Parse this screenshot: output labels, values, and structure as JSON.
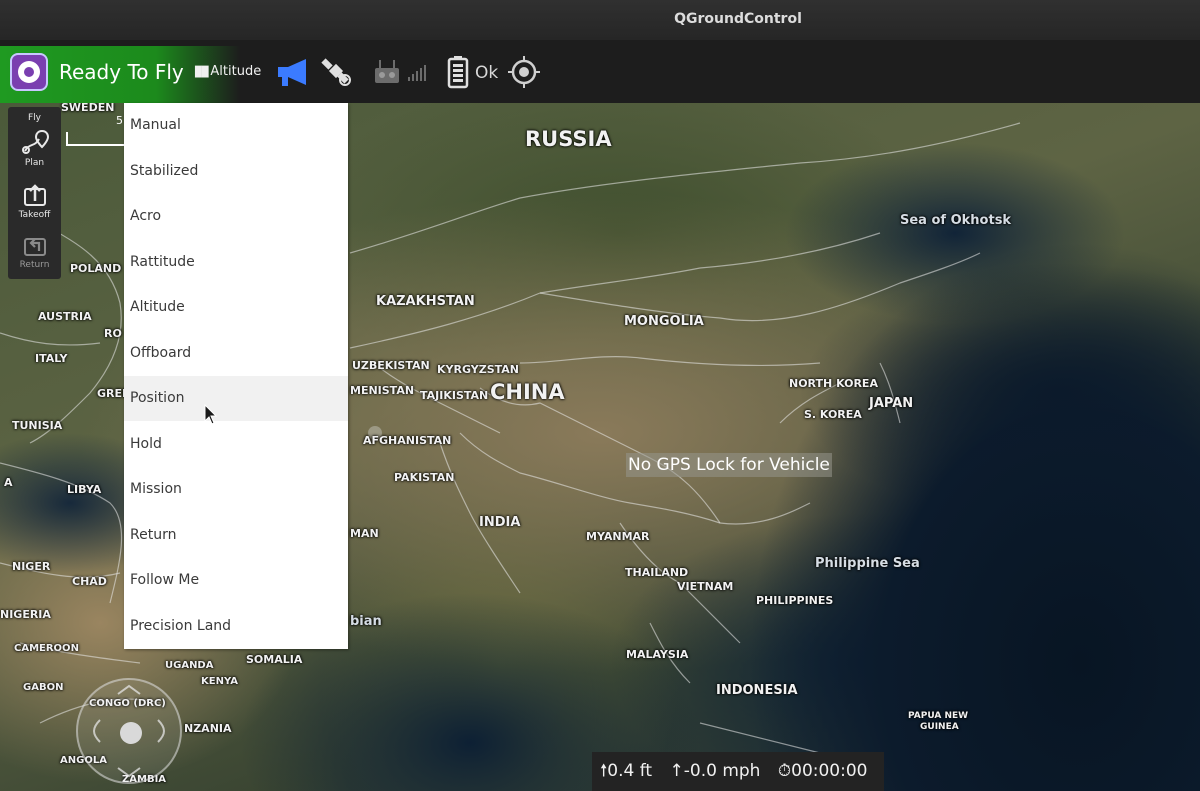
{
  "window": {
    "title": "QGroundControl"
  },
  "toolbar": {
    "status": "Ready To Fly",
    "flight_mode": "Altitude",
    "battery_status": "Ok",
    "icons": [
      "qgc-logo-icon",
      "megaphone-icon",
      "satellite-icon",
      "rc-transmitter-icon",
      "signal-bars-icon",
      "battery-icon",
      "gps-target-icon"
    ],
    "armed_color": "#1f9a21",
    "accent_color": "#3b7bff"
  },
  "toolstrip": {
    "items": [
      {
        "label": "Fly",
        "icon": "fly-icon"
      },
      {
        "label": "Plan",
        "icon": "plan-route-icon"
      },
      {
        "label": "Takeoff",
        "icon": "takeoff-icon"
      },
      {
        "label": "Return",
        "icon": "return-icon"
      }
    ]
  },
  "scale": {
    "value": "5"
  },
  "menu": {
    "items": [
      "Manual",
      "Stabilized",
      "Acro",
      "Rattitude",
      "Altitude",
      "Offboard",
      "Position",
      "Hold",
      "Mission",
      "Return",
      "Follow Me",
      "Precision Land"
    ],
    "hovered": "Position"
  },
  "map": {
    "labels": {
      "russia": "RUSSIA",
      "china": "CHINA",
      "kazakhstan": "KAZAKHSTAN",
      "mongolia": "MONGOLIA",
      "north_korea": "NORTH KOREA",
      "south_korea": "S. KOREA",
      "japan": "JAPAN",
      "sea_okhotsk": "Sea of Okhotsk",
      "philippine_sea": "Philippine Sea",
      "philippines": "PHILIPPINES",
      "india": "INDIA",
      "pakistan": "PAKISTAN",
      "afghanistan": "AFGHANISTAN",
      "uzbekistan": "UZBEKISTAN",
      "kyrgyzstan": "KYRGYZSTAN",
      "tajikistan": "TAJIKISTAN",
      "turkmenistan": "MENISTAN",
      "myanmar": "MYANMAR",
      "thailand": "THAILAND",
      "vietnam": "VIETNAM",
      "malaysia": "MALAYSIA",
      "indonesia": "INDONESIA",
      "papua": "PAPUA NEW",
      "guinea": "GUINEA",
      "sweden": "SWEDEN",
      "poland": "POLAND",
      "austria": "AUSTRIA",
      "romania": "RO",
      "italy": "ITALY",
      "greece": "GREE",
      "tunisia": "TUNISIA",
      "libya": "LIBYA",
      "niger": "NIGER",
      "chad": "CHAD",
      "nigeria": "NIGERIA",
      "cameroon": "CAMEROON",
      "gabon": "GABON",
      "congo": "CONGO (DRC)",
      "uganda": "UGANDA",
      "kenya": "KENYA",
      "somalia": "SOMALIA",
      "tanzania": "NZANIA",
      "angola": "ANGOLA",
      "zambia": "ZAMBIA",
      "oman": "MAN",
      "arabian": "bian",
      "africa_a": "A"
    },
    "gps_warning": "No GPS Lock for Vehicle"
  },
  "telemetry": {
    "altitude": "0.4 ft",
    "vertical_speed": "-0.0 mph",
    "flight_time": "00:00:00"
  }
}
